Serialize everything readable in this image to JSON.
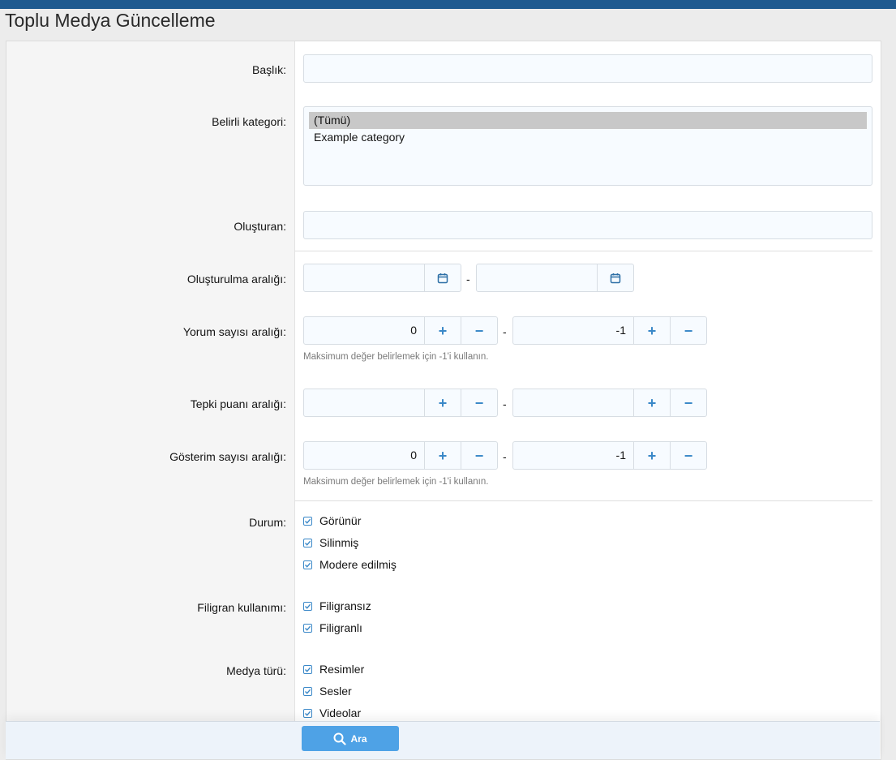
{
  "page": {
    "title": "Toplu Medya Güncelleme"
  },
  "form": {
    "title_label": "Başlık:",
    "title_value": "",
    "category_label": "Belirli kategori:",
    "category_options": [
      "(Tümü)",
      "Example category"
    ],
    "creator_label": "Oluşturan:",
    "creator_value": "",
    "created_range_label": "Oluşturulma aralığı:",
    "comment_range_label": "Yorum sayısı aralığı:",
    "comment_min": "0",
    "comment_max": "-1",
    "reaction_range_label": "Tepki puanı aralığı:",
    "reaction_min": "",
    "reaction_max": "",
    "view_range_label": "Gösterim sayısı aralığı:",
    "view_min": "0",
    "view_max": "-1",
    "hint": "Maksimum değer belirlemek için -1'i kullanın.",
    "dash": "-",
    "status_label": "Durum:",
    "status_options": [
      "Görünür",
      "Silinmiş",
      "Modere edilmiş"
    ],
    "watermark_label": "Filigran kullanımı:",
    "watermark_options": [
      "Filigransız",
      "Filigranlı"
    ],
    "media_type_label": "Medya türü:",
    "media_type_options": [
      "Resimler",
      "Sesler",
      "Videolar"
    ],
    "stepper_plus": "+",
    "stepper_minus": "−"
  },
  "footer": {
    "search_label": "Ara"
  },
  "colors": {
    "accent": "#3a88c8",
    "button": "#4ea2e6",
    "topbar": "#1f5a8f"
  }
}
